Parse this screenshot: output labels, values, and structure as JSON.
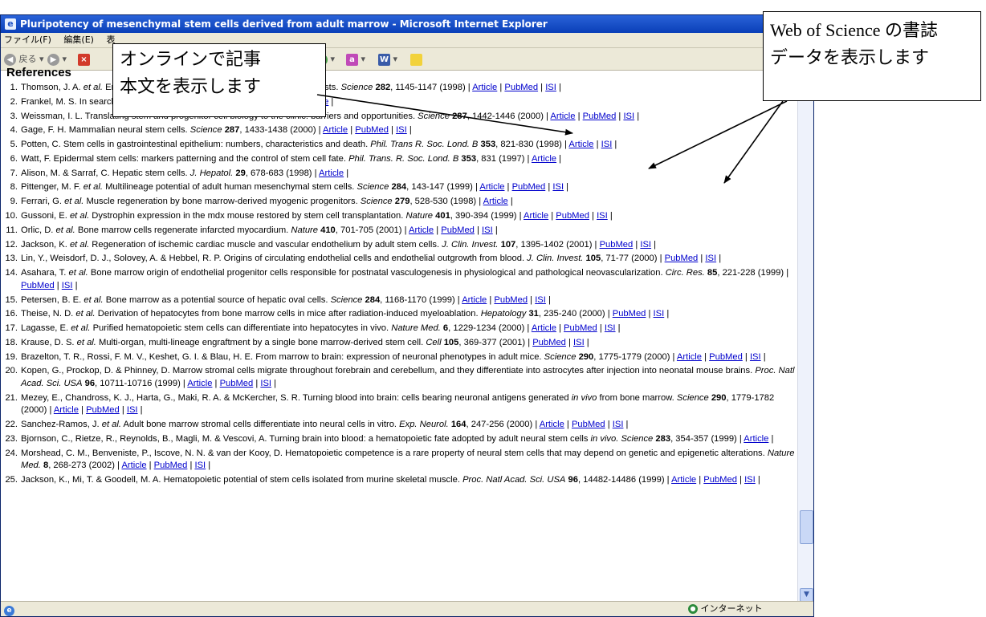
{
  "window": {
    "title": "Pluripotency of mesenchymal stem cells derived from adult marrow - Microsoft Internet Explorer"
  },
  "menu": [
    "ファイル(F)",
    "編集(E)",
    "表"
  ],
  "toolbar": {
    "back_label": "戻る"
  },
  "callouts": {
    "left": [
      "オンラインで記事",
      "本文を表示します"
    ],
    "right": [
      "Web of Science の書誌",
      "データを表示します"
    ]
  },
  "references": {
    "heading": "References",
    "items": [
      {
        "num": "1.",
        "text": "Thomson, J. A. <i>et al.</i> Embryonic stem cell lines derived from human blastocysts. <i>Science</i> <b>282</b>, 1145-1147 (1998) | <a>Article</a> | <a>PubMed</a> | <a>ISI</a> |"
      },
      {
        "num": "2.",
        "text": "Frankel, M. S. In search of stem cell policy. <i>Science</i> <b>298</b>, 1397 (2000) | <a>Article</a> |"
      },
      {
        "num": "3.",
        "text": "Weissman, I. L. Translating stem and progenitor cell biology to the clinic: barriers and opportunities. <i>Science</i> <b>287</b>, 1442-1446 (2000) | <a>Article</a> | <a>PubMed</a> | <a>ISI</a> |"
      },
      {
        "num": "4.",
        "text": "Gage, F. H. Mammalian neural stem cells. <i>Science</i> <b>287</b>, 1433-1438 (2000) | <a>Article</a> | <a>PubMed</a> | <a>ISI</a> |"
      },
      {
        "num": "5.",
        "text": "Potten, C. Stem cells in gastrointestinal epithelium: numbers, characteristics and death. <i>Phil. Trans R. Soc. Lond. B</i> <b>353</b>, 821-830 (1998) | <a>Article</a> | <a>ISI</a> |"
      },
      {
        "num": "6.",
        "text": "Watt, F. Epidermal stem cells: markers patterning and the control of stem cell fate. <i>Phil. Trans. R. Soc. Lond. B</i> <b>353</b>, 831 (1997) | <a>Article</a> |"
      },
      {
        "num": "7.",
        "text": "Alison, M. &amp; Sarraf, C. Hepatic stem cells. <i>J. Hepatol.</i> <b>29</b>, 678-683 (1998) | <a>Article</a> |"
      },
      {
        "num": "8.",
        "text": "Pittenger, M. F. <i>et al.</i> Multilineage potential of adult human mesenchymal stem cells. <i>Science</i> <b>284</b>, 143-147 (1999) | <a>Article</a> | <a>PubMed</a> | <a>ISI</a> |"
      },
      {
        "num": "9.",
        "text": "Ferrari, G. <i>et al.</i> Muscle regeneration by bone marrow-derived myogenic progenitors. <i>Science</i> <b>279</b>, 528-530 (1998) | <a>Article</a> |"
      },
      {
        "num": "10.",
        "text": "Gussoni, E. <i>et al.</i> Dystrophin expression in the mdx mouse restored by stem cell transplantation. <i>Nature</i> <b>401</b>, 390-394 (1999) | <a>Article</a> | <a>PubMed</a> | <a>ISI</a> |"
      },
      {
        "num": "11.",
        "text": "Orlic, D. <i>et al.</i> Bone marrow cells regenerate infarcted myocardium. <i>Nature</i> <b>410</b>, 701-705 (2001) | <a>Article</a> | <a>PubMed</a> | <a>ISI</a> |"
      },
      {
        "num": "12.",
        "text": "Jackson, K. <i>et al.</i> Regeneration of ischemic cardiac muscle and vascular endothelium by adult stem cells. <i>J. Clin. Invest.</i> <b>107</b>, 1395-1402 (2001) | <a>PubMed</a> | <a>ISI</a> |"
      },
      {
        "num": "13.",
        "text": "Lin, Y., Weisdorf, D. J., Solovey, A. &amp; Hebbel, R. P. Origins of circulating endothelial cells and endothelial outgrowth from blood. <i>J. Clin. Invest.</i> <b>105</b>, 71-77 (2000) | <a>PubMed</a> | <a>ISI</a> |"
      },
      {
        "num": "14.",
        "text": "Asahara, T. <i>et al.</i> Bone marrow origin of endothelial progenitor cells responsible for postnatal vasculogenesis in physiological and pathological neovascularization. <i>Circ. Res.</i> <b>85</b>, 221-228 (1999) | <a>PubMed</a> | <a>ISI</a> |"
      },
      {
        "num": "15.",
        "text": "Petersen, B. E. <i>et al.</i> Bone marrow as a potential source of hepatic oval cells. <i>Science</i> <b>284</b>, 1168-1170 (1999) | <a>Article</a> | <a>PubMed</a> | <a>ISI</a> |"
      },
      {
        "num": "16.",
        "text": "Theise, N. D. <i>et al.</i> Derivation of hepatocytes from bone marrow cells in mice after radiation-induced myeloablation. <i>Hepatology</i> <b>31</b>, 235-240 (2000) | <a>PubMed</a> | <a>ISI</a> |"
      },
      {
        "num": "17.",
        "text": "Lagasse, E. <i>et al.</i> Purified hematopoietic stem cells can differentiate into hepatocytes in vivo. <i>Nature Med.</i> <b>6</b>, 1229-1234 (2000) | <a>Article</a> | <a>PubMed</a> | <a>ISI</a> |"
      },
      {
        "num": "18.",
        "text": "Krause, D. S. <i>et al.</i> Multi-organ, multi-lineage engraftment by a single bone marrow-derived stem cell. <i>Cell</i> <b>105</b>, 369-377 (2001) | <a>PubMed</a> | <a>ISI</a> |"
      },
      {
        "num": "19.",
        "text": "Brazelton, T. R., Rossi, F. M. V., Keshet, G. I. &amp; Blau, H. E. From marrow to brain: expression of neuronal phenotypes in adult mice. <i>Science</i> <b>290</b>, 1775-1779 (2000) | <a>Article</a> | <a>PubMed</a> | <a>ISI</a> |"
      },
      {
        "num": "20.",
        "text": "Kopen, G., Prockop, D. &amp; Phinney, D. Marrow stromal cells migrate throughout forebrain and cerebellum, and they differentiate into astrocytes after injection into neonatal mouse brains. <i>Proc. Natl Acad. Sci. USA</i> <b>96</b>, 10711-10716 (1999) | <a>Article</a> | <a>PubMed</a> | <a>ISI</a> |"
      },
      {
        "num": "21.",
        "text": "Mezey, E., Chandross, K. J., Harta, G., Maki, R. A. &amp; McKercher, S. R. Turning blood into brain: cells bearing neuronal antigens generated <i>in vivo</i> from bone marrow. <i>Science</i> <b>290</b>, 1779-1782 (2000) | <a>Article</a> | <a>PubMed</a> | <a>ISI</a> |"
      },
      {
        "num": "22.",
        "text": "Sanchez-Ramos, J. <i>et al.</i> Adult bone marrow stromal cells differentiate into neural cells in vitro. <i>Exp. Neurol.</i> <b>164</b>, 247-256 (2000) | <a>Article</a> | <a>PubMed</a> | <a>ISI</a> |"
      },
      {
        "num": "23.",
        "text": "Bjornson, C., Rietze, R., Reynolds, B., Magli, M. &amp; Vescovi, A. Turning brain into blood: a hematopoietic fate adopted by adult neural stem cells <i>in vivo.</i> <i>Science</i> <b>283</b>, 354-357 (1999) | <a>Article</a> |"
      },
      {
        "num": "24.",
        "text": "Morshead, C. M., Benveniste, P., Iscove, N. N. &amp; van der Kooy, D. Hematopoietic competence is a rare property of neural stem cells that may depend on genetic and epigenetic alterations. <i>Nature Med.</i> <b>8</b>, 268-273 (2002) | <a>Article</a> | <a>PubMed</a> | <a>ISI</a> |"
      },
      {
        "num": "25.",
        "text": "Jackson, K., Mi, T. &amp; Goodell, M. A. Hematopoietic potential of stem cells isolated from murine skeletal muscle. <i>Proc. Natl Acad. Sci. USA</i> <b>96</b>, 14482-14486 (1999) | <a>Article</a> | <a>PubMed</a> | <a>ISI</a> |"
      }
    ]
  },
  "status": {
    "zone": "インターネット"
  }
}
